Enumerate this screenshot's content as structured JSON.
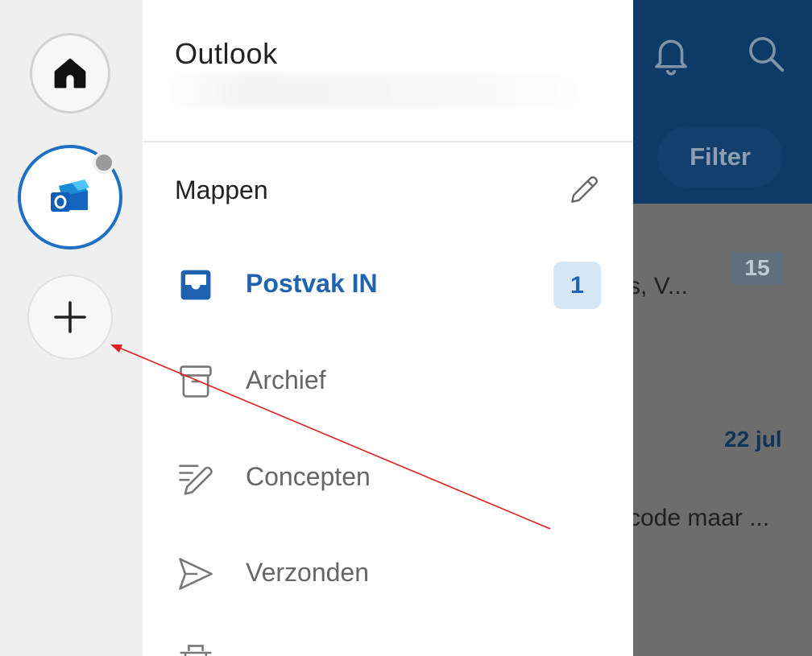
{
  "drawer": {
    "app_name": "Outlook",
    "section_title": "Mappen",
    "folders": [
      {
        "label": "Postvak IN",
        "icon": "inbox-icon",
        "active": true,
        "count": "1"
      },
      {
        "label": "Archief",
        "icon": "archive-icon",
        "active": false
      },
      {
        "label": "Concepten",
        "icon": "drafts-icon",
        "active": false
      },
      {
        "label": "Verzonden",
        "icon": "sent-icon",
        "active": false
      }
    ]
  },
  "rail": {
    "items": [
      "home-icon",
      "outlook-account-icon",
      "plus-icon"
    ]
  },
  "background": {
    "filter_label": "Filter",
    "message_badge": "15",
    "snippet_1": "s, V...",
    "date_2": "22 jul",
    "snippet_2": "code maar ..."
  },
  "colors": {
    "accent": "#1f63b0",
    "badge_bg": "#d5e6f5",
    "header_bg": "#0d3a66",
    "annotation": "#e02020"
  }
}
